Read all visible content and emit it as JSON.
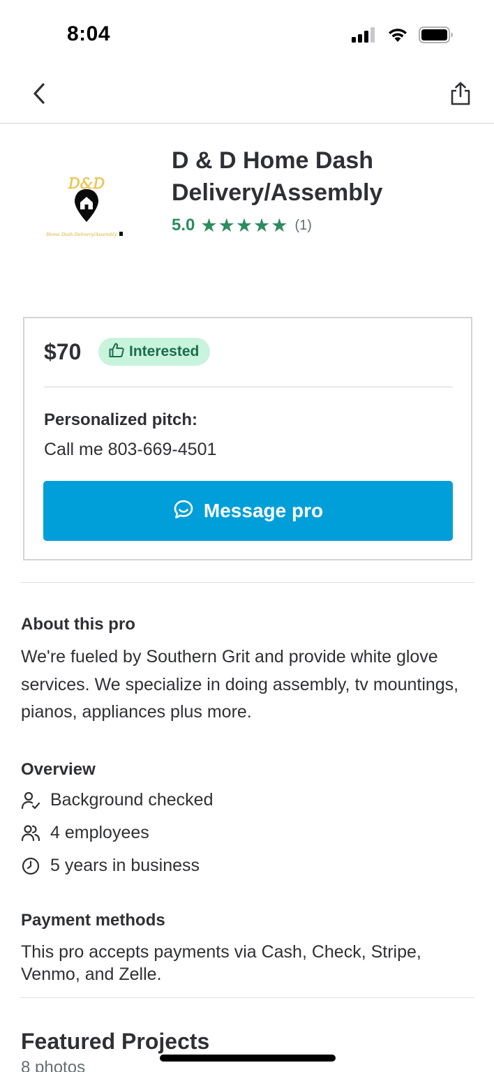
{
  "status_bar": {
    "time": "8:04",
    "signal_icon": "cellular-signal-icon",
    "wifi_icon": "wifi-icon",
    "battery_icon": "battery-icon"
  },
  "nav": {
    "back_icon": "chevron-left-icon",
    "share_icon": "share-icon"
  },
  "pro": {
    "logo_text": "D&D",
    "logo_tagline": "Home Dash Delivery/Assembly",
    "name": "D & D Home Dash Delivery/Assembly",
    "rating": "5.0",
    "stars": 5,
    "review_count": "(1)",
    "rating_color": "#2d8c5f"
  },
  "quote": {
    "price": "$70",
    "status_label": "Interested",
    "pitch_heading": "Personalized pitch:",
    "pitch_text": "Call me 803-669-4501",
    "message_button_label": "Message pro",
    "button_color": "#009fd9"
  },
  "about": {
    "heading": "About this pro",
    "text": "We're fueled by Southern Grit and provide white glove services. We specialize in doing assembly, tv mountings, pianos, appliances plus more."
  },
  "overview": {
    "heading": "Overview",
    "items": [
      {
        "icon": "user-check-icon",
        "label": "Background checked"
      },
      {
        "icon": "users-icon",
        "label": "4 employees"
      },
      {
        "icon": "clock-icon",
        "label": "5 years in business"
      }
    ]
  },
  "payment": {
    "heading": "Payment methods",
    "text": "This pro accepts payments via Cash, Check, Stripe, Venmo, and Zelle."
  },
  "featured": {
    "title": "Featured Projects",
    "photo_count": "8 photos"
  }
}
